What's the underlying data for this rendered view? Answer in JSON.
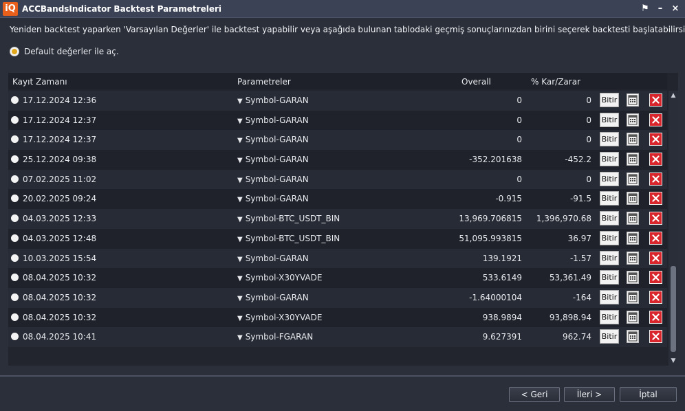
{
  "window": {
    "logo_text": "iQ",
    "title": "ACCBandsIndicator Backtest Parametreleri",
    "controls": {
      "pin": "⚑",
      "minimize": "–",
      "close": "×"
    }
  },
  "description": "Yeniden backtest yaparken 'Varsayılan Değerler' ile backtest yapabilir veya aşağıda bulunan tablodaki geçmiş sonuçlarınızdan birini seçerek backtesti başlatabilirsiniz.",
  "default_option": {
    "label": "Default değerler ile aç.",
    "selected": true
  },
  "table": {
    "columns": {
      "kayit_zamani": "Kayıt Zamanı",
      "parametreler": "Parametreler",
      "overall": "Overall",
      "kar_zarar": "% Kar/Zarar"
    },
    "bitir_label": "Bitir",
    "rows": [
      {
        "date": "17.12.2024 12:36",
        "param": "Symbol-GARAN",
        "overall": "0",
        "kar": "0"
      },
      {
        "date": "17.12.2024 12:37",
        "param": "Symbol-GARAN",
        "overall": "0",
        "kar": "0"
      },
      {
        "date": "17.12.2024 12:37",
        "param": "Symbol-GARAN",
        "overall": "0",
        "kar": "0"
      },
      {
        "date": "25.12.2024 09:38",
        "param": "Symbol-GARAN",
        "overall": "-352.201638",
        "kar": "-452.2"
      },
      {
        "date": "07.02.2025 11:02",
        "param": "Symbol-GARAN",
        "overall": "0",
        "kar": "0"
      },
      {
        "date": "20.02.2025 09:24",
        "param": "Symbol-GARAN",
        "overall": "-0.915",
        "kar": "-91.5"
      },
      {
        "date": "04.03.2025 12:33",
        "param": "Symbol-BTC_USDT_BIN",
        "overall": "13,969.706815",
        "kar": "1,396,970.68"
      },
      {
        "date": "04.03.2025 12:48",
        "param": "Symbol-BTC_USDT_BIN",
        "overall": "51,095.993815",
        "kar": "36.97"
      },
      {
        "date": "10.03.2025 15:54",
        "param": "Symbol-GARAN",
        "overall": "139.1921",
        "kar": "-1.57"
      },
      {
        "date": "08.04.2025 10:32",
        "param": "Symbol-X30YVADE",
        "overall": "533.6149",
        "kar": "53,361.49"
      },
      {
        "date": "08.04.2025 10:32",
        "param": "Symbol-GARAN",
        "overall": "-1.64000104",
        "kar": "-164"
      },
      {
        "date": "08.04.2025 10:32",
        "param": "Symbol-X30YVADE",
        "overall": "938.9894",
        "kar": "93,898.94"
      },
      {
        "date": "08.04.2025 10:41",
        "param": "Symbol-FGARAN",
        "overall": "9.627391",
        "kar": "962.74"
      }
    ]
  },
  "footer": {
    "back": "< Geri",
    "next": "İleri >",
    "cancel": "İptal"
  },
  "colors": {
    "accent": "#e0a81a",
    "logo": "#e8601c",
    "delete": "#d9262c"
  }
}
